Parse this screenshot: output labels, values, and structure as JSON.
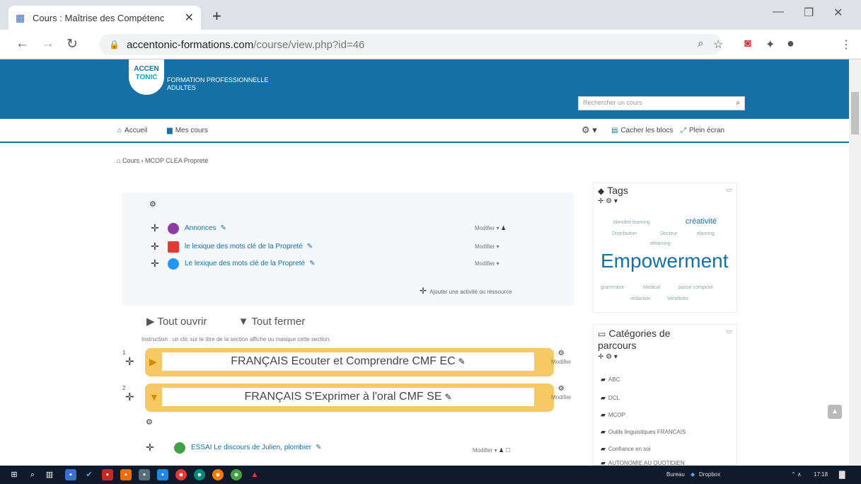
{
  "browser": {
    "tab_title": "Cours : Maîtrise des Compétenc",
    "url_host": "accentonic-formations.com",
    "url_path": "/course/view.php?id=46"
  },
  "site": {
    "logo_line1": "ACCEN",
    "logo_line2": "TONIC",
    "tagline1": "FORMATION PROFESSIONNELLE",
    "tagline2": "ADULTES",
    "search_placeholder": "Rechercher un cours"
  },
  "navbar": {
    "home": "Accueil",
    "my_courses": "Mes cours",
    "hide_blocks": "Cacher les blocs",
    "fullscreen": "Plein écran"
  },
  "breadcrumb": "Cours › MCOP CLEA Propreté",
  "section0": {
    "activities": [
      {
        "label": "Annonces",
        "modifier": "Modifier ▾"
      },
      {
        "label": "le lexique des mots clé de la Propreté",
        "modifier": "Modifier ▾"
      },
      {
        "label": "Le lexique des mots clé de la Propreté",
        "modifier": "Modifier ▾"
      }
    ],
    "add_activity": "Ajouter une activité ou ressource"
  },
  "toggle": {
    "open_all": "Tout ouvrir",
    "close_all": "Tout fermer",
    "instruction": "Instruction : un clic sur le titre de la section affiche ou masque cette section."
  },
  "sections": [
    {
      "num": "1",
      "title": "FRANÇAIS Ecouter et Comprendre CMF EC",
      "edit": "Modifier"
    },
    {
      "num": "2",
      "title": "FRANÇAIS S'Exprimer à l'oral CMF SE",
      "edit": "Modifier"
    }
  ],
  "sub_activity": {
    "label": "ESSAI Le discours de Julien, plombier",
    "modifier": "Modifier ▾"
  },
  "tags_block": {
    "title": "Tags",
    "tags": [
      "blended learning",
      "créativité",
      "Distribution",
      "Docteur",
      "elarning",
      "elearning",
      "Empowerment",
      "grammaire",
      "Medical",
      "passé composé",
      "rédaction",
      "Vertébrés"
    ]
  },
  "categories_block": {
    "title_line1": "Catégories de",
    "title_line2": "parcours",
    "items": [
      "ABC",
      "DCL",
      "MCOP",
      "Outils linguistiques FRANCAIS",
      "Confiance en soi",
      "AUTONOMIE AU QUOTIDIEN"
    ]
  },
  "taskbar": {
    "desk_label": "Bureau",
    "dropbox": "Dropbox",
    "time": "17:18"
  },
  "colors": {
    "brand_blue": "#1570a6",
    "section_yellow": "#f7c965",
    "taskbar": "#101a2b"
  }
}
